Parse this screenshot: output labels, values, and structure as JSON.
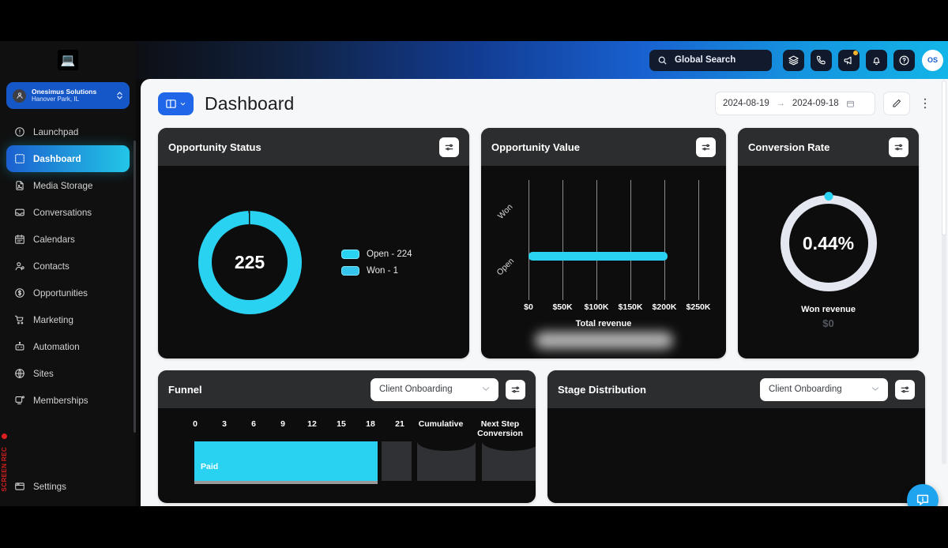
{
  "sidebar": {
    "logo_icon": "laptop-logo-icon",
    "org": {
      "name": "Onesimus Solutions",
      "location": "Hanover Park, IL",
      "avatar_icon": "person-avatar-icon",
      "chevron_icon": "chevron-up-down-icon"
    },
    "items": [
      {
        "label": "Launchpad",
        "icon": "rocket-alert-icon",
        "active": false
      },
      {
        "label": "Dashboard",
        "icon": "dashboard-icon",
        "active": true
      },
      {
        "label": "Media Storage",
        "icon": "image-file-icon",
        "active": false
      },
      {
        "label": "Conversations",
        "icon": "inbox-icon",
        "active": false
      },
      {
        "label": "Calendars",
        "icon": "calendar-icon",
        "active": false
      },
      {
        "label": "Contacts",
        "icon": "contacts-icon",
        "active": false
      },
      {
        "label": "Opportunities",
        "icon": "dollar-circle-icon",
        "active": false
      },
      {
        "label": "Marketing",
        "icon": "cart-icon",
        "active": false
      },
      {
        "label": "Automation",
        "icon": "robot-icon",
        "active": false
      },
      {
        "label": "Sites",
        "icon": "globe-icon",
        "active": false
      },
      {
        "label": "Memberships",
        "icon": "monitor-icon",
        "active": false
      }
    ],
    "bottom_items": [
      {
        "label": "Settings",
        "icon": "settings-window-icon"
      }
    ],
    "collapse_icon": "chevron-left-icon",
    "recording_label": "SCREEN REC"
  },
  "topbar": {
    "search": {
      "placeholder": "Global Search",
      "icon": "search-icon"
    },
    "buttons": [
      {
        "name": "layers-button",
        "icon": "layers-icon",
        "badge": false
      },
      {
        "name": "phone-button",
        "icon": "phone-icon",
        "badge": false
      },
      {
        "name": "announcement-button",
        "icon": "megaphone-icon",
        "badge": true
      },
      {
        "name": "notifications-button",
        "icon": "bell-icon",
        "badge": false
      },
      {
        "name": "help-button",
        "icon": "question-mark-icon",
        "badge": false
      }
    ],
    "avatar_initials": "OS"
  },
  "page": {
    "title": "Dashboard",
    "layout_icon": "layout-panel-icon",
    "layout_chevron": "chevron-down-icon",
    "date_range": {
      "start": "2024-08-19",
      "end": "2024-09-18",
      "arrow": "→",
      "calendar_icon": "calendar-icon"
    },
    "edit_icon": "pencil-edit-icon",
    "more_icon": "kebab-menu-icon",
    "settings_icon": "sliders-settings-icon"
  },
  "cards": {
    "opportunity_status": {
      "title": "Opportunity Status",
      "center_value": "225",
      "legend": [
        {
          "label": "Open - 224",
          "color": "#2ad2f2"
        },
        {
          "label": "Won - 1",
          "color": "#35c5ec"
        }
      ]
    },
    "opportunity_value": {
      "title": "Opportunity Value",
      "footer_label": "Total revenue",
      "footer_value_blurred": true
    },
    "conversion_rate": {
      "title": "Conversion Rate",
      "value": "0.44%",
      "caption": "Won revenue",
      "sub_value": "$0"
    },
    "funnel": {
      "title": "Funnel",
      "pipeline": "Client Onboarding",
      "columns": [
        "Cumulative",
        "Next Step Conversion"
      ],
      "bar_label": "Paid"
    },
    "stage_distribution": {
      "title": "Stage Distribution",
      "pipeline": "Client Onboarding"
    }
  },
  "chat_fab_icon": "chat-info-bubble-icon",
  "colors": {
    "accent_cyan": "#2ad2f2",
    "brand_blue": "#1f67e8",
    "card_bg": "#0d0d0e",
    "card_head": "#2c2d2f",
    "page_bg": "#f6f7f9"
  },
  "chart_data": [
    {
      "type": "pie",
      "name": "opportunity-status-donut",
      "title": "Opportunity Status",
      "labels": [
        "Open",
        "Won"
      ],
      "values": [
        224,
        1
      ],
      "total": 225,
      "colors": [
        "#2ad2f2",
        "#35c5ec"
      ],
      "legend": "right"
    },
    {
      "type": "bar",
      "name": "opportunity-value-bar",
      "title": "Opportunity Value",
      "orientation": "horizontal",
      "categories": [
        "Won",
        "Open"
      ],
      "values": [
        0,
        205000
      ],
      "xlabel": "",
      "ylabel": "",
      "xticks": [
        "$0",
        "$50K",
        "$100K",
        "$150K",
        "$200K",
        "$250K"
      ],
      "xtick_values": [
        0,
        50000,
        100000,
        150000,
        200000,
        250000
      ],
      "xlim": [
        0,
        250000
      ],
      "grid": true,
      "bar_color": "#2ad2f2",
      "footer_label": "Total revenue"
    },
    {
      "type": "pie",
      "name": "conversion-rate-gauge",
      "title": "Conversion Rate",
      "labels": [
        "Converted",
        "Remaining"
      ],
      "values": [
        0.44,
        99.56
      ],
      "display_value": "0.44%",
      "colors": [
        "#2ad2f2",
        "#e4e7ef"
      ],
      "caption": "Won revenue",
      "caption_value": "$0"
    },
    {
      "type": "bar",
      "name": "funnel-chart",
      "title": "Funnel",
      "orientation": "horizontal",
      "categories": [
        "Paid"
      ],
      "values": [
        19
      ],
      "xticks": [
        "0",
        "3",
        "6",
        "9",
        "12",
        "15",
        "18",
        "21"
      ],
      "xtick_values": [
        0,
        3,
        6,
        9,
        12,
        15,
        18,
        21
      ],
      "xlim": [
        0,
        21
      ],
      "extra_columns": [
        "Cumulative",
        "Next Step Conversion"
      ],
      "bar_color": "#2ad2f2",
      "grid": false
    }
  ]
}
